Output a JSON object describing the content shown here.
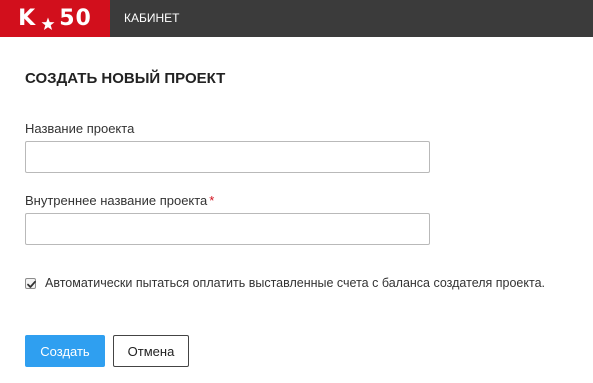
{
  "header": {
    "logo_left": "K",
    "logo_right": "50",
    "logo_star_icon": "star-icon",
    "nav_item": "КАБИНЕТ",
    "colors": {
      "logo_bg": "#d20f1c",
      "bar_bg": "#3b3b3b"
    }
  },
  "form": {
    "title": "СОЗДАТЬ НОВЫЙ ПРОЕКТ",
    "project_name": {
      "label": "Название проекта",
      "value": "",
      "placeholder": ""
    },
    "internal_name": {
      "label": "Внутреннее название проекта",
      "required_mark": "*",
      "value": "",
      "placeholder": ""
    },
    "auto_pay": {
      "checked": true,
      "label": "Автоматически пытаться оплатить выставленные счета с баланса создателя проекта."
    },
    "buttons": {
      "create": "Создать",
      "cancel": "Отмена"
    },
    "colors": {
      "primary": "#2f9ff0",
      "required": "#d20f1c"
    }
  }
}
